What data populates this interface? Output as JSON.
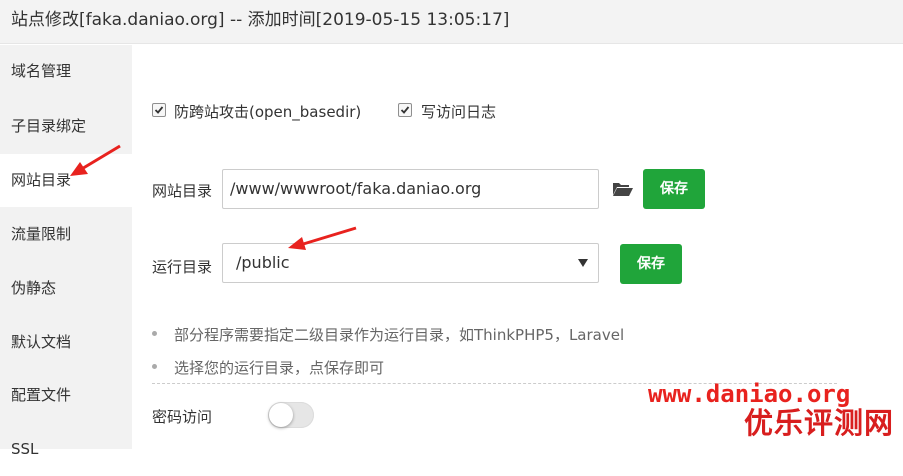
{
  "window": {
    "title": "站点修改[faka.daniao.org] -- 添加时间[2019-05-15 13:05:17]"
  },
  "sidebar": {
    "items": [
      {
        "label": "域名管理"
      },
      {
        "label": "子目录绑定"
      },
      {
        "label": "网站目录",
        "active": true
      },
      {
        "label": "流量限制"
      },
      {
        "label": "伪静态"
      },
      {
        "label": "默认文档"
      },
      {
        "label": "配置文件"
      },
      {
        "label": "SSL"
      }
    ]
  },
  "options": {
    "open_basedir": {
      "label": "防跨站攻击(open_basedir)",
      "checked": true
    },
    "access_log": {
      "label": "写访问日志",
      "checked": true
    }
  },
  "site_dir": {
    "label": "网站目录",
    "value": "/www/wwwroot/faka.daniao.org",
    "folder_icon": "folder-open-icon",
    "save_label": "保存"
  },
  "run_dir": {
    "label": "运行目录",
    "selected": "/public",
    "save_label": "保存"
  },
  "hints": [
    "部分程序需要指定二级目录作为运行目录，如ThinkPHP5，Laravel",
    "选择您的运行目录，点保存即可"
  ],
  "password_access": {
    "label": "密码访问",
    "enabled": false
  },
  "watermark": {
    "url": "www.daniao.org",
    "name": "优乐评测网"
  },
  "colors": {
    "accent": "#20a53a",
    "annotation": "#e8221e",
    "sidebar_bg": "#f2f2f2"
  }
}
